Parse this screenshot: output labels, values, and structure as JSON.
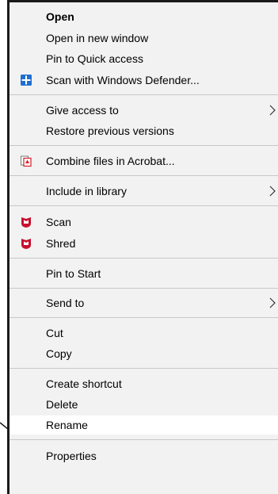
{
  "menu": {
    "open": "Open",
    "open_new_window": "Open in new window",
    "pin_quick_access": "Pin to Quick access",
    "scan_defender": "Scan with Windows Defender...",
    "give_access": "Give access to",
    "restore_versions": "Restore previous versions",
    "combine_acrobat": "Combine files in Acrobat...",
    "include_library": "Include in library",
    "scan": "Scan",
    "shred": "Shred",
    "pin_start": "Pin to Start",
    "send_to": "Send to",
    "cut": "Cut",
    "copy": "Copy",
    "create_shortcut": "Create shortcut",
    "delete": "Delete",
    "rename": "Rename",
    "properties": "Properties"
  },
  "icons": {
    "defender": "windows-defender-shield-icon",
    "acrobat": "acrobat-combine-icon",
    "mcafee": "mcafee-shield-icon",
    "submenu": "chevron-right-icon"
  },
  "colors": {
    "defender_blue": "#1f6fd1",
    "mcafee_red": "#c8102e",
    "acrobat_red": "#d4202a"
  }
}
